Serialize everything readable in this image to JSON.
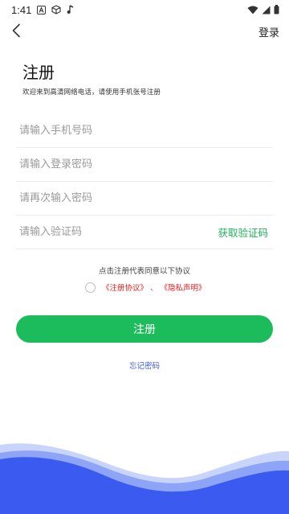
{
  "status_bar": {
    "time": "1:41",
    "icons_left": [
      "font-a-icon",
      "cube-icon",
      "music-note-icon"
    ],
    "icons_right": [
      "wifi-icon",
      "signal-icon",
      "battery-icon"
    ]
  },
  "nav": {
    "back_icon": "chevron-left-icon",
    "login_label": "登录"
  },
  "header": {
    "title": "注册",
    "subtitle": "欢迎来到高清网络电话，请使用手机张号注册"
  },
  "form": {
    "phone_placeholder": "请输入手机号码",
    "password_placeholder": "请输入登录密码",
    "confirm_password_placeholder": "请再次输入密码",
    "code_placeholder": "请输入验证码",
    "get_code_label": "获取验证码"
  },
  "agreement": {
    "note": "点击注册代表同意以下协议",
    "terms_label": "《注册协议》",
    "separator": "、",
    "privacy_label": "《隐私声明》"
  },
  "actions": {
    "register_label": "注册",
    "forgot_label": "忘记密码"
  },
  "colors": {
    "accent_green": "#1cbb5c",
    "link_blue": "#3a5bd6",
    "agreement_red": "#e02020",
    "wave_blue": "#3b5bf0"
  }
}
